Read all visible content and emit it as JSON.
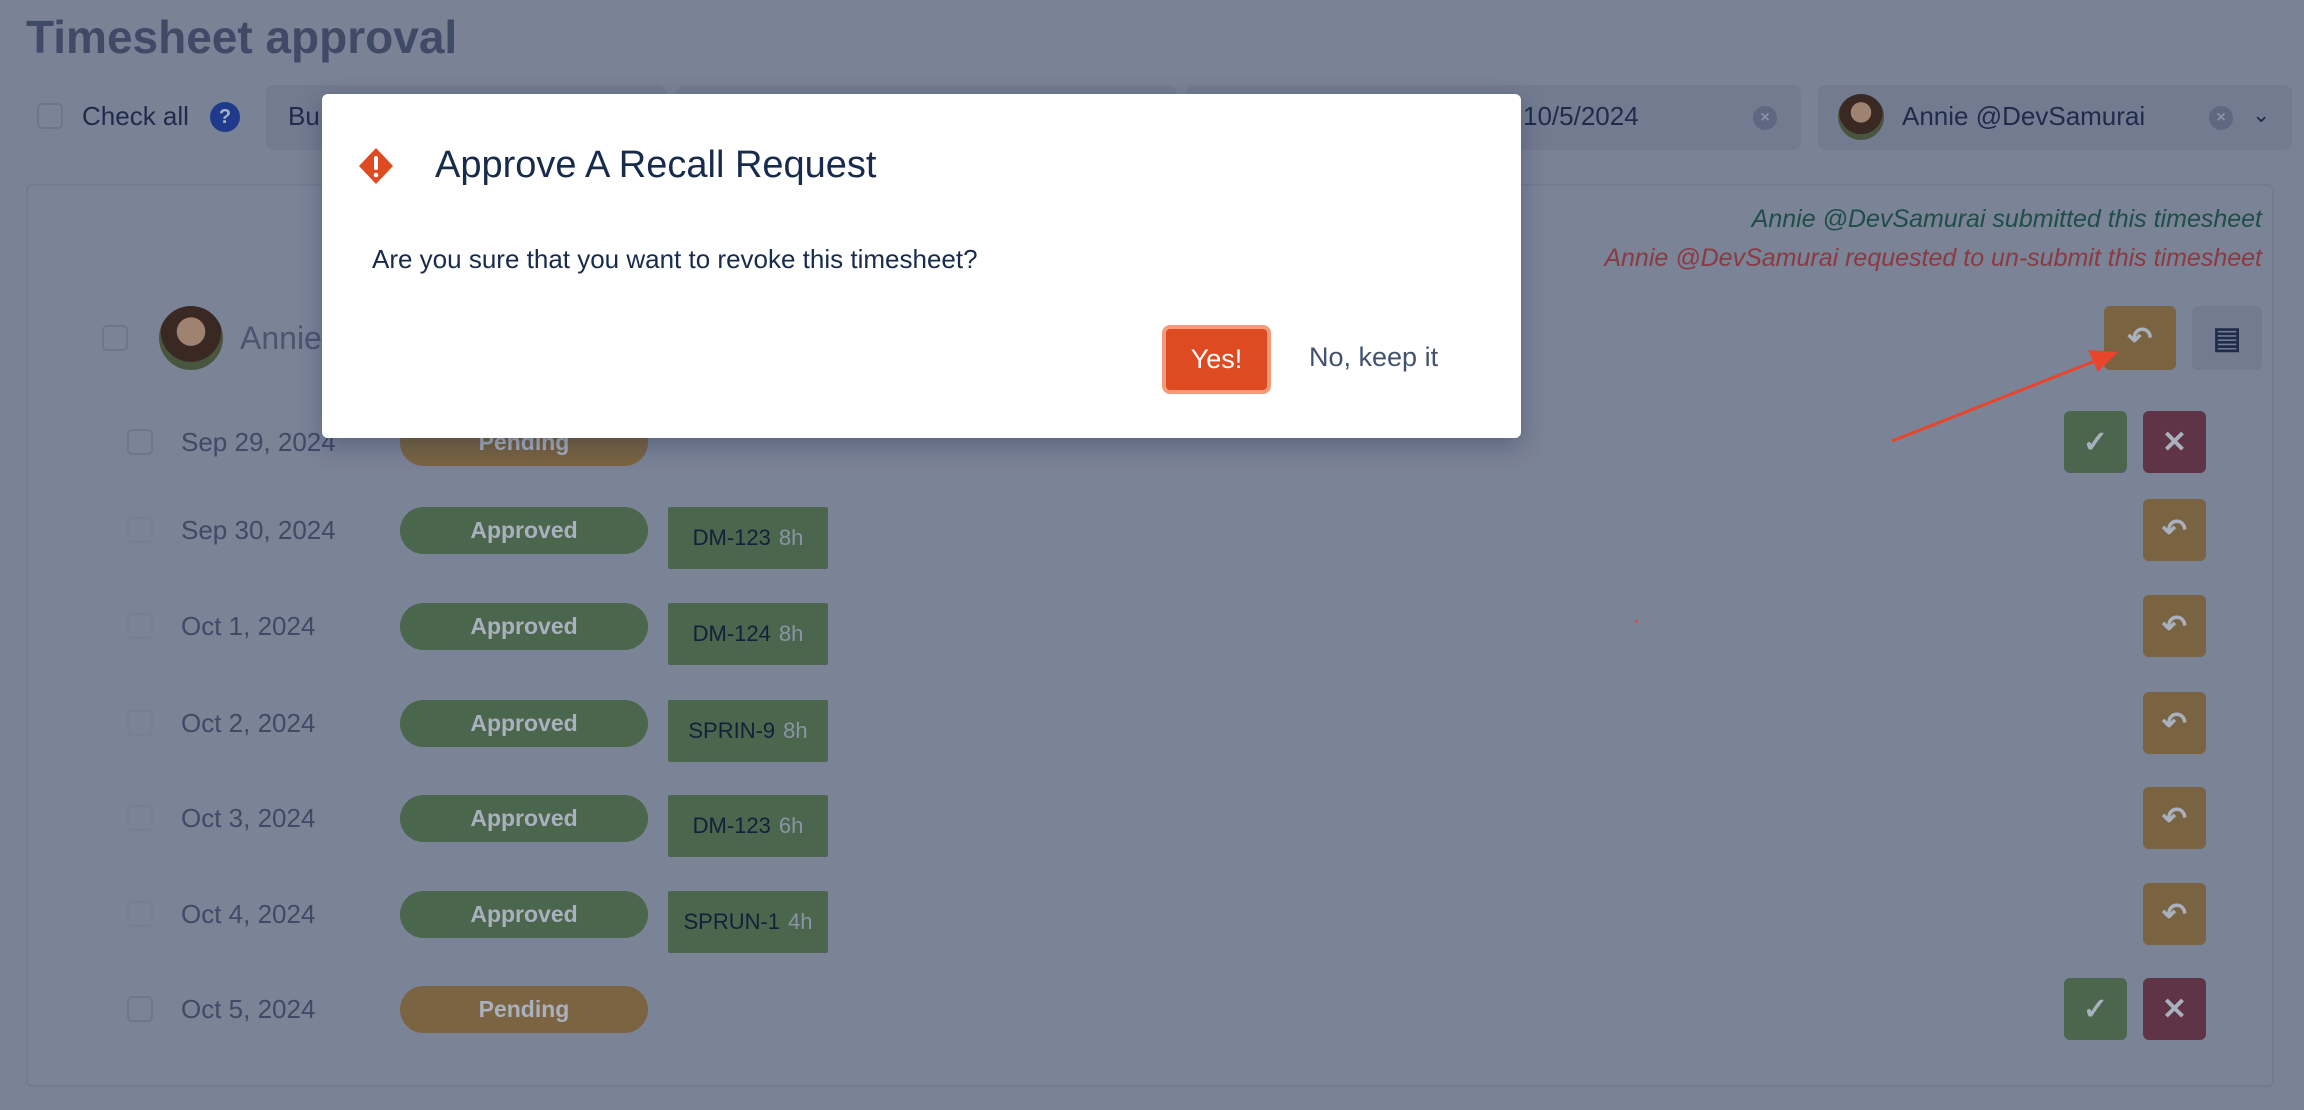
{
  "page": {
    "title": "Timesheet approval"
  },
  "toolbar": {
    "check_all_label": "Check all",
    "help_icon": "?",
    "filter1_text": "Bu",
    "date_text": "10/5/2024",
    "user_name": "Annie @DevSamurai"
  },
  "panel": {
    "log_submitted": "Annie @DevSamurai submitted this timesheet",
    "log_recall": "Annie @DevSamurai requested to un-submit this timesheet",
    "user_name": "Annie",
    "rows": [
      {
        "date": "Sep 29, 2024",
        "status": "Pending"
      },
      {
        "date": "Sep 30, 2024",
        "status": "Approved",
        "issue": "DM-123",
        "hours": "8h"
      },
      {
        "date": "Oct 1, 2024",
        "status": "Approved",
        "issue": "DM-124",
        "hours": "8h"
      },
      {
        "date": "Oct 2, 2024",
        "status": "Approved",
        "issue": "SPRIN-9",
        "hours": "8h"
      },
      {
        "date": "Oct 3, 2024",
        "status": "Approved",
        "issue": "DM-123",
        "hours": "6h"
      },
      {
        "date": "Oct 4, 2024",
        "status": "Approved",
        "issue": "SPRUN-1",
        "hours": "4h"
      },
      {
        "date": "Oct 5, 2024",
        "status": "Pending"
      }
    ]
  },
  "modal": {
    "title": "Approve A Recall Request",
    "body": "Are you sure that you want to revoke this timesheet?",
    "confirm_label": "Yes!",
    "cancel_label": "No, keep it",
    "icon": "warning-diamond-icon"
  },
  "colors": {
    "approved": "#36b37e",
    "pending": "#ffab00",
    "danger": "#de350b",
    "annotation": "#e8452c"
  }
}
